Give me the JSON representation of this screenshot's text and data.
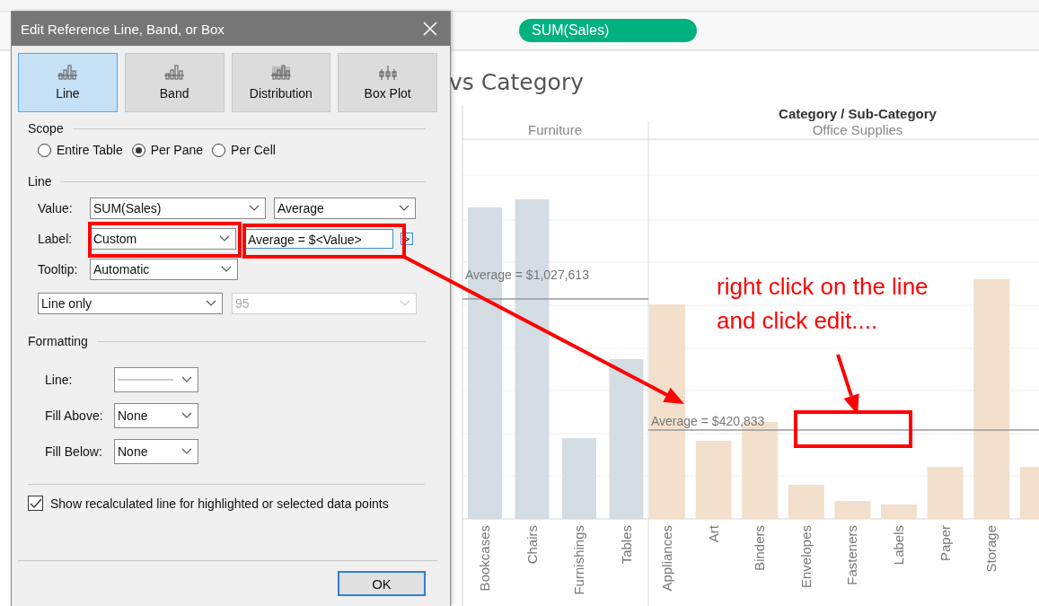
{
  "shelf": {
    "pill": "SUM(Sales)"
  },
  "sheet": {
    "title": "vs Category",
    "header": "Category / Sub-Category",
    "panes": [
      {
        "name": "Furniture",
        "kind": "furniture",
        "average_label": "Average = $1,027,613",
        "bars": [
          "Bookcases",
          "Chairs",
          "Furnishings",
          "Tables"
        ]
      },
      {
        "name": "Office Supplies",
        "kind": "office",
        "average_label": "Average = $420,833",
        "bars": [
          "Appliances",
          "Art",
          "Binders",
          "Envelopes",
          "Fasteners",
          "Labels",
          "Paper",
          "Storage"
        ]
      }
    ]
  },
  "dialog": {
    "title": "Edit Reference Line, Band, or Box",
    "types": [
      {
        "label": "Line",
        "selected": true
      },
      {
        "label": "Band",
        "selected": false
      },
      {
        "label": "Distribution",
        "selected": false
      },
      {
        "label": "Box Plot",
        "selected": false
      }
    ],
    "scope": {
      "heading": "Scope",
      "options": [
        {
          "label": "Entire Table",
          "selected": false
        },
        {
          "label": "Per Pane",
          "selected": true
        },
        {
          "label": "Per Cell",
          "selected": false
        }
      ]
    },
    "line": {
      "heading": "Line",
      "rows": [
        {
          "label": "Value:",
          "fields": [
            {
              "kind": "select",
              "value": "SUM(Sales)"
            },
            {
              "kind": "select",
              "value": "Average"
            }
          ]
        },
        {
          "label": "Label:",
          "fields": [
            {
              "kind": "select",
              "value": "Custom"
            },
            {
              "kind": "text",
              "value": "Average = $<Value>"
            },
            {
              "kind": "insert",
              "value": ">"
            }
          ]
        },
        {
          "label": "Tooltip:",
          "fields": [
            {
              "kind": "select",
              "value": "Automatic"
            }
          ]
        }
      ],
      "extra": [
        {
          "value": "Line only",
          "disabled": false
        },
        {
          "value": "95",
          "disabled": true
        }
      ]
    },
    "formatting": {
      "heading": "Formatting",
      "rows": [
        {
          "label": "Line:",
          "kind": "line-style"
        },
        {
          "label": "Fill Above:",
          "kind": "select",
          "value": "None"
        },
        {
          "label": "Fill Below:",
          "kind": "select",
          "value": "None"
        }
      ]
    },
    "checkbox": {
      "label": "Show recalculated line for highlighted or selected data points",
      "checked": true
    },
    "ok": "OK"
  },
  "annotation": {
    "note": [
      "right click on the line",
      "and click edit...."
    ]
  }
}
